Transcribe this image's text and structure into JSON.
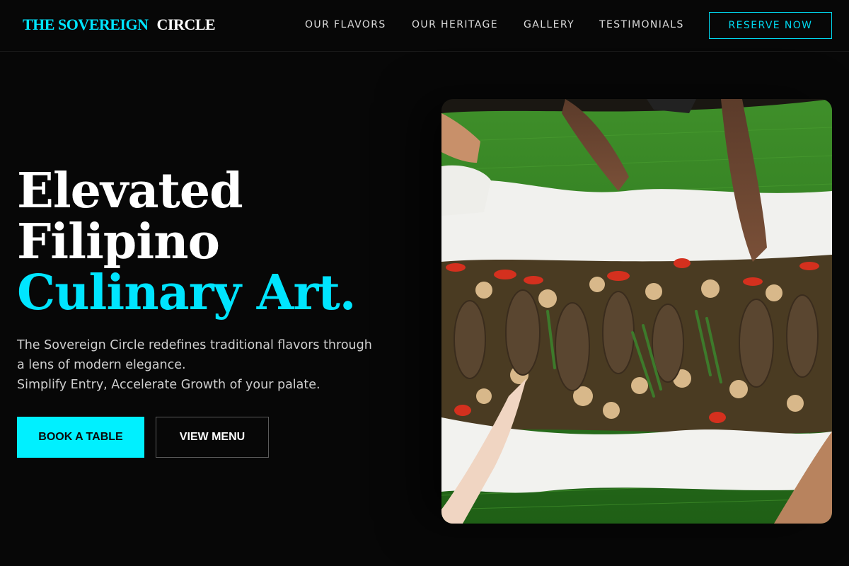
{
  "header": {
    "logo_accent": "THE SOVEREIGN",
    "logo_rest": "CIRCLE",
    "nav": [
      "OUR FLAVORS",
      "OUR HERITAGE",
      "GALLERY",
      "TESTIMONIALS"
    ],
    "cta": "RESERVE NOW"
  },
  "hero": {
    "headline_line1": "Elevated",
    "headline_line2": "Filipino",
    "headline_line3": "Culinary Art.",
    "description_line1": "The Sovereign Circle redefines traditional flavors through",
    "description_line2": "a lens of modern elegance.",
    "description_line3": "Simplify Entry, Accelerate Growth of your palate.",
    "primary_button": "BOOK A TABLE",
    "secondary_button": "VIEW MENU",
    "image_subject": "boodle-fight-feast-photo"
  },
  "colors": {
    "accent": "#00e5ff",
    "background": "#070707"
  }
}
